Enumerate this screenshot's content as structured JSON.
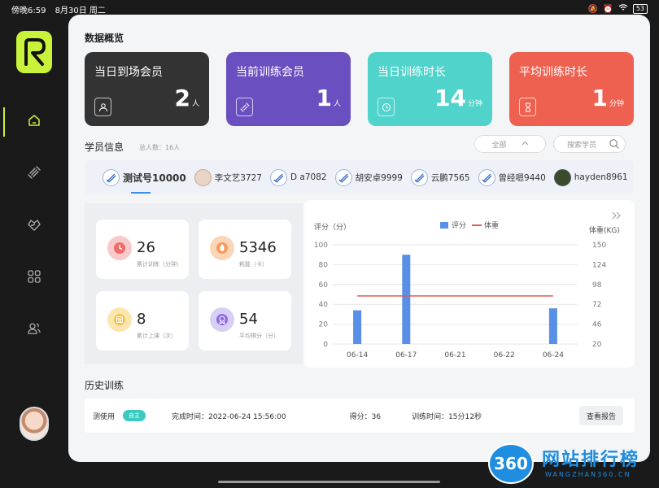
{
  "status_bar": {
    "time": "傍晚6:59",
    "date": "8月30日 周二",
    "battery": "53"
  },
  "colors": {
    "accent": "#c9f23a",
    "card1": "#333333",
    "card2": "#6a4fc0",
    "card3": "#4fd3cb",
    "card4": "#ee6150",
    "bar": "#5a8fe8",
    "line": "#e25a4a"
  },
  "sidebar": {
    "logo_icon": "r-logo-icon",
    "items": [
      {
        "icon": "home-icon"
      },
      {
        "icon": "dumbbell-icon"
      },
      {
        "icon": "heart-icon"
      },
      {
        "icon": "grid-icon"
      },
      {
        "icon": "users-icon"
      }
    ]
  },
  "overview": {
    "title": "数据概览",
    "cards": [
      {
        "label": "当日到场会员",
        "value": "2",
        "unit": "人",
        "icon": "person-icon"
      },
      {
        "label": "当前训练会员",
        "value": "1",
        "unit": "人",
        "icon": "dumbbell-icon"
      },
      {
        "label": "当日训练时长",
        "value": "14",
        "unit": "分钟",
        "icon": "clock-icon"
      },
      {
        "label": "平均训练时长",
        "value": "1",
        "unit": "分钟",
        "icon": "hourglass-icon"
      }
    ]
  },
  "members": {
    "title": "学员信息",
    "total": "总人数：16人",
    "filter": "全部",
    "search_placeholder": "搜索学员",
    "list": [
      {
        "name": "测试号10000",
        "active": true
      },
      {
        "name": "李文艺3727"
      },
      {
        "name": "D a7082"
      },
      {
        "name": "胡安卓9999"
      },
      {
        "name": "云鹏7565"
      },
      {
        "name": "曾经嗯9440"
      },
      {
        "name": "hayden8961"
      }
    ]
  },
  "stats": [
    {
      "value": "26",
      "label": "累计训练（分钟）",
      "icon": "clock-icon"
    },
    {
      "value": "5346",
      "label": "耗能（卡）",
      "icon": "flame-icon"
    },
    {
      "value": "8",
      "label": "累计上课（次）",
      "icon": "calendar-icon"
    },
    {
      "value": "54",
      "label": "平均得分（分）",
      "icon": "medal-icon"
    }
  ],
  "chart_data": {
    "type": "bar",
    "ylabel": "评分（分）",
    "y2label": "体重(KG)",
    "categories": [
      "06-14",
      "06-17",
      "06-21",
      "06-22",
      "06-24"
    ],
    "series": [
      {
        "name": "评分",
        "type": "bar",
        "values": [
          34,
          90,
          0,
          0,
          36
        ]
      },
      {
        "name": "体重",
        "type": "line",
        "values": [
          83,
          83,
          83,
          83,
          83
        ]
      }
    ],
    "ylim": [
      0,
      100
    ],
    "y2lim": [
      20,
      150
    ],
    "yticks": [
      "0",
      "20",
      "40",
      "60",
      "80",
      "100"
    ],
    "y2ticks": [
      "20",
      "46",
      "72",
      "98",
      "124",
      "150"
    ],
    "grid": true,
    "legend": "top"
  },
  "history": {
    "title": "历史训练",
    "rows": [
      {
        "name": "测使用",
        "tag": "自主",
        "time": "完成时间：2022-06-24 15:56:00",
        "score": "得分：36",
        "duration": "训练时间：15分12秒",
        "button": "查看报告"
      }
    ]
  },
  "watermark": {
    "num": "360",
    "title": "网站排行榜",
    "sub": "WANGZHAN360.CN"
  }
}
